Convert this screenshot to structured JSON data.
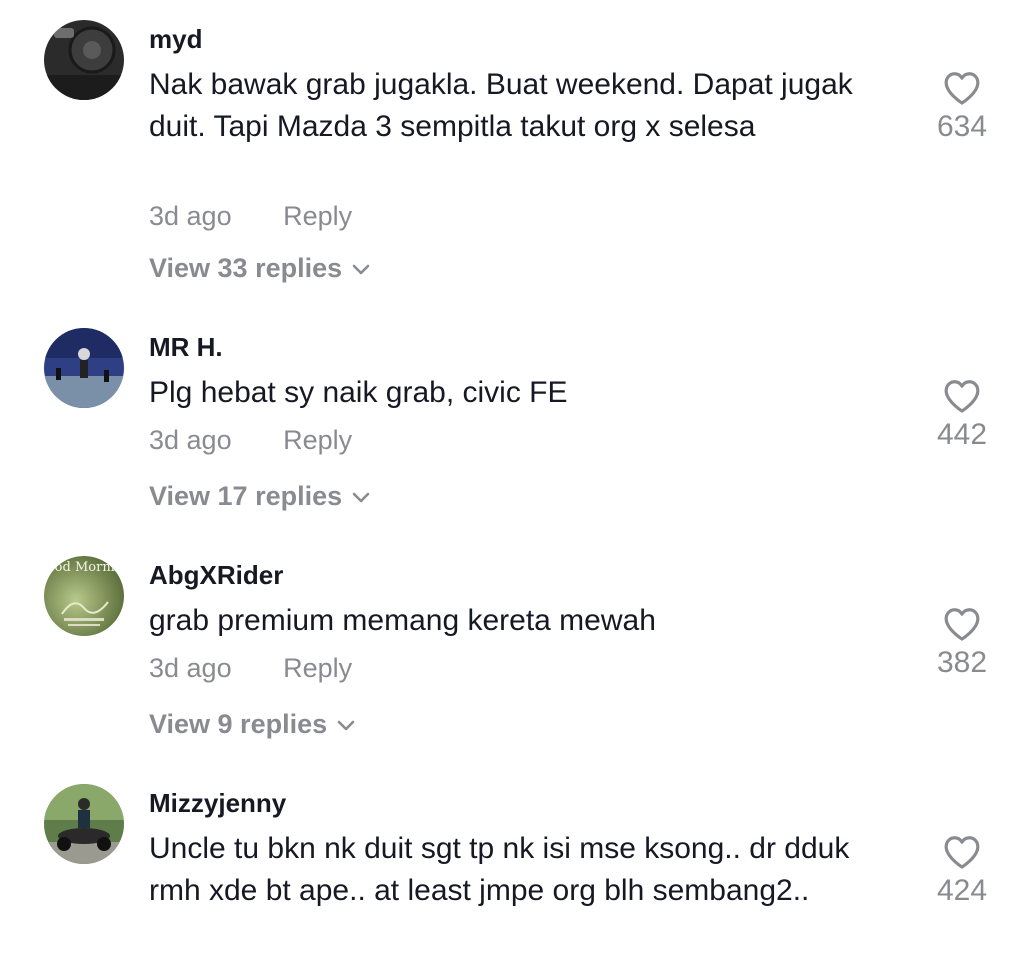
{
  "comments": [
    {
      "username": "myd",
      "text": "Nak bawak grab jugakla. Buat weekend. Dapat jugak duit. Tapi Mazda 3 sempitla takut org x selesa",
      "time": "3d ago",
      "reply_label": "Reply",
      "view_replies": "View 33 replies",
      "likes": "634"
    },
    {
      "username": "MR H.",
      "text": "Plg hebat sy naik grab, civic FE",
      "time": "3d ago",
      "reply_label": "Reply",
      "view_replies": "View 17 replies",
      "likes": "442"
    },
    {
      "username": "AbgXRider",
      "text": "grab premium memang kereta mewah",
      "time": "3d ago",
      "reply_label": "Reply",
      "view_replies": "View 9 replies",
      "likes": "382"
    },
    {
      "username": "Mizzyjenny",
      "text": "Uncle tu bkn nk duit sgt tp nk isi mse ksong.. dr dduk rmh xde bt ape.. at least jmpe org blh sembang2..",
      "likes": "424"
    }
  ],
  "avatar_3_text": "Good Morning",
  "icons": {
    "like": "heart-outline-icon",
    "expand": "chevron-down-icon"
  },
  "colors": {
    "text_primary": "#161823",
    "text_secondary": "#8a8b91",
    "background": "#ffffff"
  }
}
